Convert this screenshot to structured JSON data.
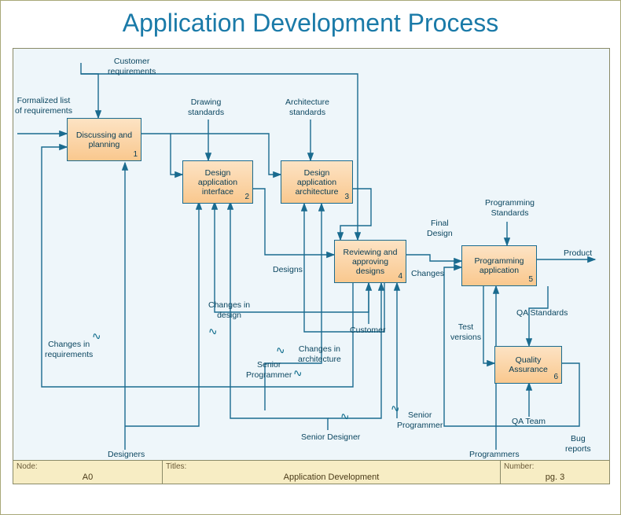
{
  "title": "Application Development Process",
  "boxes": {
    "b1": {
      "label": "Discussing and planning",
      "num": "1"
    },
    "b2": {
      "label": "Design application interface",
      "num": "2"
    },
    "b3": {
      "label": "Design application architecture",
      "num": "3"
    },
    "b4": {
      "label": "Reviewing and approving designs",
      "num": "4"
    },
    "b5": {
      "label": "Programming application",
      "num": "5"
    },
    "b6": {
      "label": "Quality Assurance",
      "num": "6"
    }
  },
  "labels": {
    "cust_req": "Customer\nrequirements",
    "formalized": "Formalized list\nof requirements",
    "drawing": "Drawing\nstandards",
    "arch_std": "Architecture\nstandards",
    "prog_std": "Programming\nStandards",
    "final_design": "Final\nDesign",
    "product": "Product",
    "designs": "Designs",
    "changes": "Changes",
    "changes_design": "Changes in\ndesign",
    "changes_req": "Changes in\nrequirements",
    "changes_arch": "Changes in\narchitecture",
    "customer": "Customer",
    "senior_prog1": "Senior\nProgrammer",
    "senior_designer": "Senior Designer",
    "senior_prog2": "Senior\nProgrammer",
    "designers": "Designers",
    "programmers": "Programmers",
    "qa_team": "QA Team",
    "qa_std": "QA Standards",
    "test_ver": "Test\nversions",
    "bug_reports": "Bug\nreports"
  },
  "footer": {
    "node_h": "Node:",
    "node_v": "A0",
    "title_h": "Titles:",
    "title_v": "Application Development",
    "num_h": "Number:",
    "num_v": "pg. 3"
  }
}
